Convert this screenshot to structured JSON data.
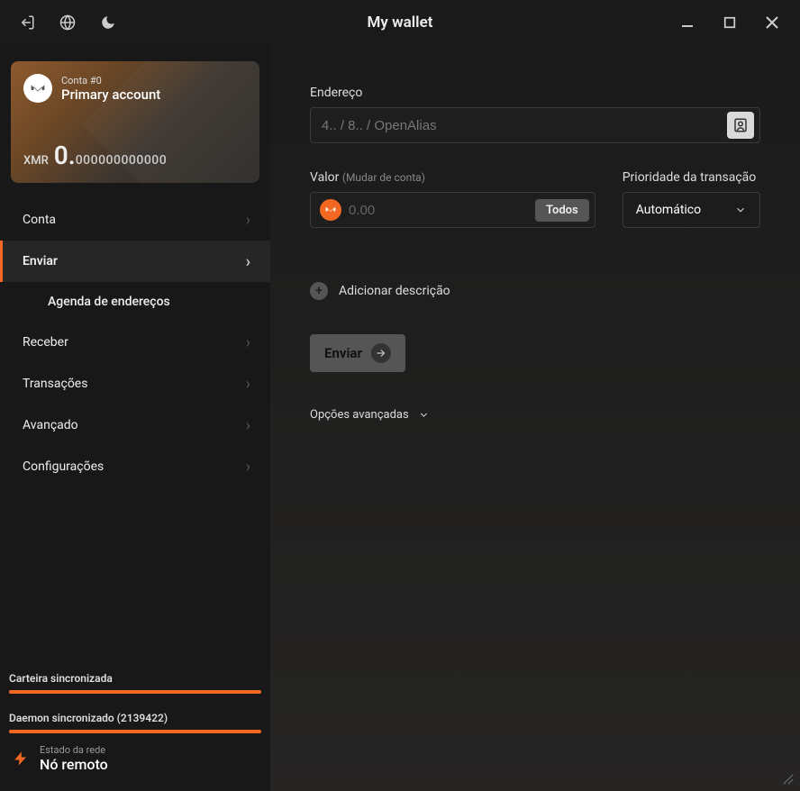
{
  "title": "My wallet",
  "card": {
    "conta_label": "Conta #0",
    "account_name": "Primary account",
    "currency": "XMR",
    "balance_int": "0.",
    "balance_dec": "000000000000"
  },
  "nav": {
    "conta": "Conta",
    "enviar": "Enviar",
    "agenda": "Agenda de endereços",
    "receber": "Receber",
    "transacoes": "Transações",
    "avancado": "Avançado",
    "configuracoes": "Configurações"
  },
  "status": {
    "wallet_sync": "Carteira sincronizada",
    "daemon_sync": "Daemon sincronizado (2139422)",
    "network_label": "Estado da rede",
    "network_value": "Nó remoto"
  },
  "main": {
    "address_label": "Endereço",
    "address_placeholder": "4.. / 8.. / OpenAlias",
    "amount_label": "Valor",
    "amount_sub": "(Mudar de conta)",
    "amount_placeholder": "0.00",
    "btn_all": "Todos",
    "priority_label": "Prioridade da transação",
    "priority_value": "Automático",
    "add_description": "Adicionar descrição",
    "send_button": "Enviar",
    "advanced": "Opções avançadas"
  }
}
